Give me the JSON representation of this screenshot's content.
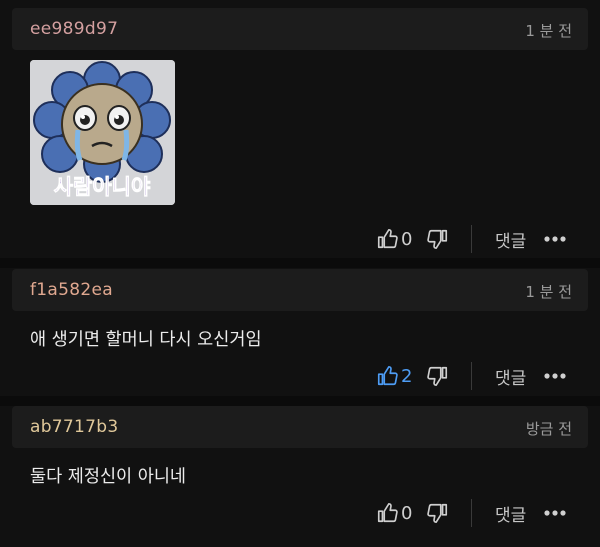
{
  "colors": {
    "background": "#111111",
    "header_bg": "#1c1c1c",
    "author1": "#d4a0a0",
    "author2": "#e0a890",
    "author3": "#e0c89a",
    "like_active": "#4e9df5"
  },
  "comments": [
    {
      "author": "ee989d97",
      "time": "1 분 전",
      "text": "",
      "sticker_text": "사람아니야",
      "likes": "0",
      "liked": false,
      "reply_label": "댓글"
    },
    {
      "author": "f1a582ea",
      "time": "1 분 전",
      "text": "애 생기면 할머니 다시 오신거임",
      "likes": "2",
      "liked": true,
      "reply_label": "댓글"
    },
    {
      "author": "ab7717b3",
      "time": "방금 전",
      "text": "둘다 제정신이 아니네",
      "likes": "0",
      "liked": false,
      "reply_label": "댓글"
    }
  ],
  "icons": {
    "like": "thumbs-up-icon",
    "dislike": "thumbs-down-icon",
    "more": "more-dots-icon"
  }
}
